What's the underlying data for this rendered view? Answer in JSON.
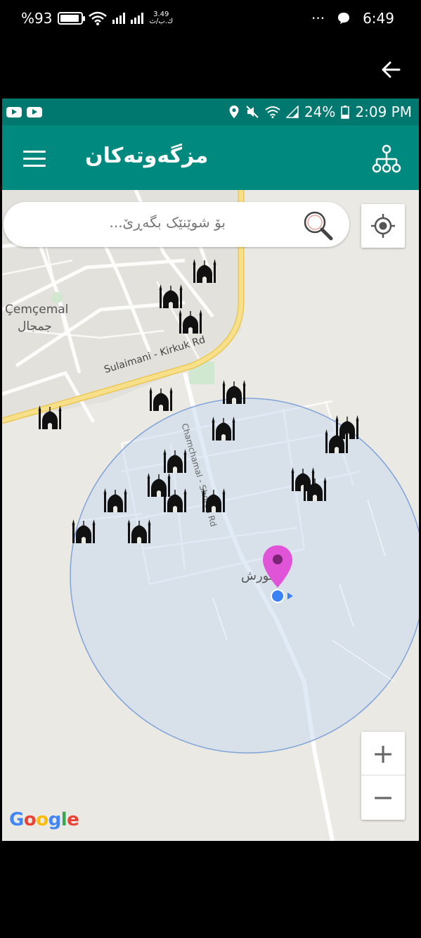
{
  "device_status": {
    "battery_text": "%93",
    "battery_level_percent": 93,
    "net_speed": "3.49",
    "net_speed_unit": "ك.ب/ث",
    "dots": "···",
    "time": "6:49"
  },
  "inner_status": {
    "battery_text": "24%",
    "time": "2:09 PM"
  },
  "app": {
    "title": "مزگەوتەکان"
  },
  "search": {
    "placeholder": "بۆ شوێنێک بگەڕێ..."
  },
  "map": {
    "place_label_latin": "Çemçemal",
    "place_label_arabic": "جمجال",
    "road_label_main": "Sulaimani - Kirkuk Rd",
    "road_label_side": "Chamchamal - Shorsh Rd",
    "marker_label": "شورش",
    "zoom_in_label": "+",
    "zoom_out_label": "−",
    "google_letters": [
      "G",
      "o",
      "o",
      "g",
      "l",
      "e"
    ]
  },
  "colors": {
    "app_bar": "#008a7f",
    "status_bar": "#00786f",
    "marker_pin": "#e055d8",
    "user_dot": "#3b82f6",
    "radius_circle": "#c9daf0",
    "road_yellow": "#f4d46b"
  },
  "icons": {
    "menu": "menu-icon",
    "tree": "hierarchy-icon",
    "search": "search-icon",
    "locate": "my-location-icon",
    "mosque": "mosque-icon",
    "back": "back-arrow-icon"
  }
}
